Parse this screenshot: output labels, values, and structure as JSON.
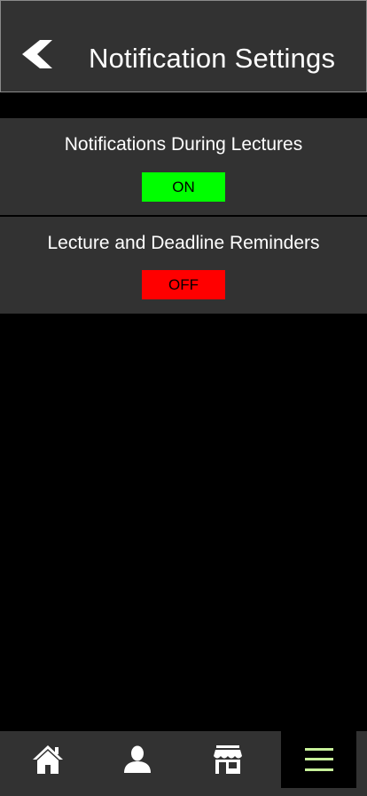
{
  "header": {
    "title": "Notification Settings",
    "back_icon": "chevron-left-icon"
  },
  "settings": [
    {
      "label": "Notifications During Lectures",
      "state": "ON",
      "color": "#00ff00"
    },
    {
      "label": "Lecture and Deadline Reminders",
      "state": "OFF",
      "color": "#ff0000"
    }
  ],
  "bottom_nav": {
    "items": [
      {
        "icon": "home-icon",
        "active": false
      },
      {
        "icon": "profile-icon",
        "active": false
      },
      {
        "icon": "store-icon",
        "active": false
      },
      {
        "icon": "menu-icon",
        "active": true
      }
    ]
  },
  "colors": {
    "background": "#000000",
    "panel": "#323232",
    "accent": "#c7f09a",
    "text": "#ffffff"
  }
}
